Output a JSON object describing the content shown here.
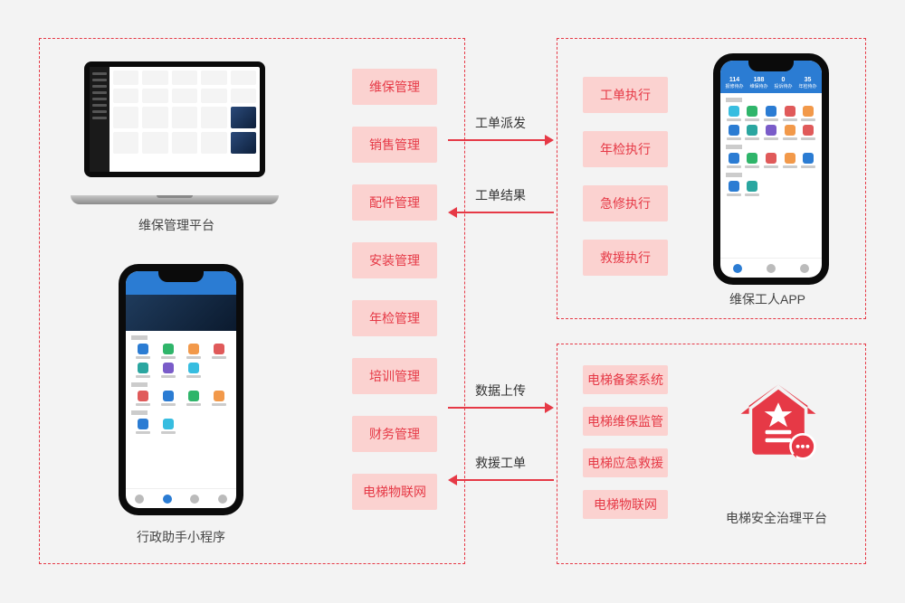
{
  "left_box": {
    "caption_platform": "维保管理平台",
    "caption_miniapp": "行政助手小程序",
    "tags": [
      "维保管理",
      "销售管理",
      "配件管理",
      "安装管理",
      "年检管理",
      "培训管理",
      "财务管理",
      "电梯物联网"
    ]
  },
  "tr_box": {
    "caption": "维保工人APP",
    "tags": [
      "工单执行",
      "年检执行",
      "急修执行",
      "救援执行"
    ]
  },
  "br_box": {
    "caption": "电梯安全治理平台",
    "tags": [
      "电梯备案系统",
      "电梯维保监管",
      "电梯应急救援",
      "电梯物联网"
    ]
  },
  "arrows": {
    "dispatch": "工单派发",
    "result": "工单结果",
    "upload": "数据上传",
    "rescue": "救援工单"
  },
  "phone_tr_stats": {
    "a_n": "114",
    "a_l": "报修待办",
    "b_n": "188",
    "b_l": "维保待办",
    "c_n": "0",
    "c_l": "投诉待办",
    "d_n": "35",
    "d_l": "年检待办"
  }
}
